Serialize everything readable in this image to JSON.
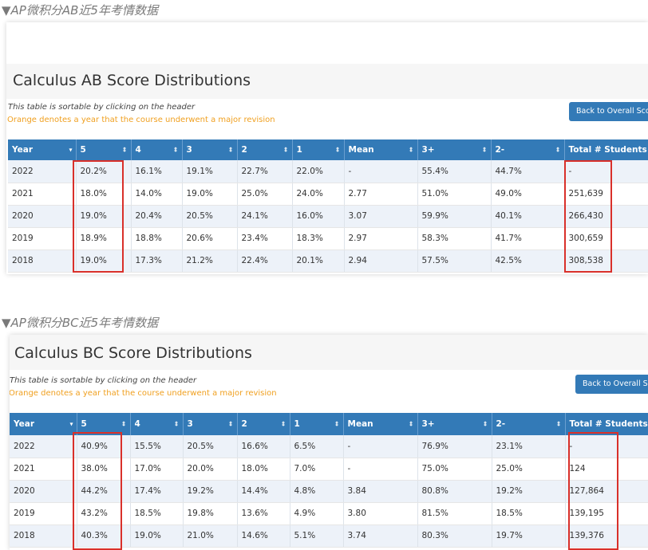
{
  "captions": {
    "ab": "▼AP微积分AB近5年考情数据",
    "bc": "▼AP微积分BC近5年考情数据"
  },
  "notes": {
    "sortable": "This table is sortable by clicking on the header",
    "orange": "Orange denotes a year that the course underwent a major revision",
    "back_button": "Back to Overall Score"
  },
  "colors": {
    "accent": "#337ab7",
    "note_orange": "#f0a020",
    "highlight": "#d9302a",
    "row_tint": "#edf2f9"
  },
  "icons": {
    "sort": "sort-arrows-icon",
    "sort_desc": "sort-desc-icon"
  },
  "headers": [
    "Year",
    "5",
    "4",
    "3",
    "2",
    "1",
    "Mean",
    "3+",
    "2-",
    "Total # Students"
  ],
  "tables": [
    {
      "title": "Calculus AB Score Distributions",
      "rows": [
        [
          "2022",
          "20.2%",
          "16.1%",
          "19.1%",
          "22.7%",
          "22.0%",
          "-",
          "55.4%",
          "44.7%",
          "-"
        ],
        [
          "2021",
          "18.0%",
          "14.0%",
          "19.0%",
          "25.0%",
          "24.0%",
          "2.77",
          "51.0%",
          "49.0%",
          "251,639"
        ],
        [
          "2020",
          "19.0%",
          "20.4%",
          "20.5%",
          "24.1%",
          "16.0%",
          "3.07",
          "59.9%",
          "40.1%",
          "266,430"
        ],
        [
          "2019",
          "18.9%",
          "18.8%",
          "20.6%",
          "23.4%",
          "18.3%",
          "2.97",
          "58.3%",
          "41.7%",
          "300,659"
        ],
        [
          "2018",
          "19.0%",
          "17.3%",
          "21.2%",
          "22.4%",
          "20.1%",
          "2.94",
          "57.5%",
          "42.5%",
          "308,538"
        ]
      ]
    },
    {
      "title": "Calculus BC Score Distributions",
      "rows": [
        [
          "2022",
          "40.9%",
          "15.5%",
          "20.5%",
          "16.6%",
          "6.5%",
          "-",
          "76.9%",
          "23.1%",
          "-"
        ],
        [
          "2021",
          "38.0%",
          "17.0%",
          "20.0%",
          "18.0%",
          "7.0%",
          "-",
          "75.0%",
          "25.0%",
          "124"
        ],
        [
          "2020",
          "44.2%",
          "17.4%",
          "19.2%",
          "14.4%",
          "4.8%",
          "3.84",
          "80.8%",
          "19.2%",
          "127,864"
        ],
        [
          "2019",
          "43.2%",
          "18.5%",
          "19.8%",
          "13.6%",
          "4.9%",
          "3.80",
          "81.5%",
          "18.5%",
          "139,195"
        ],
        [
          "2018",
          "40.3%",
          "19.0%",
          "21.0%",
          "14.6%",
          "5.1%",
          "3.74",
          "80.3%",
          "19.7%",
          "139,376"
        ]
      ]
    }
  ]
}
